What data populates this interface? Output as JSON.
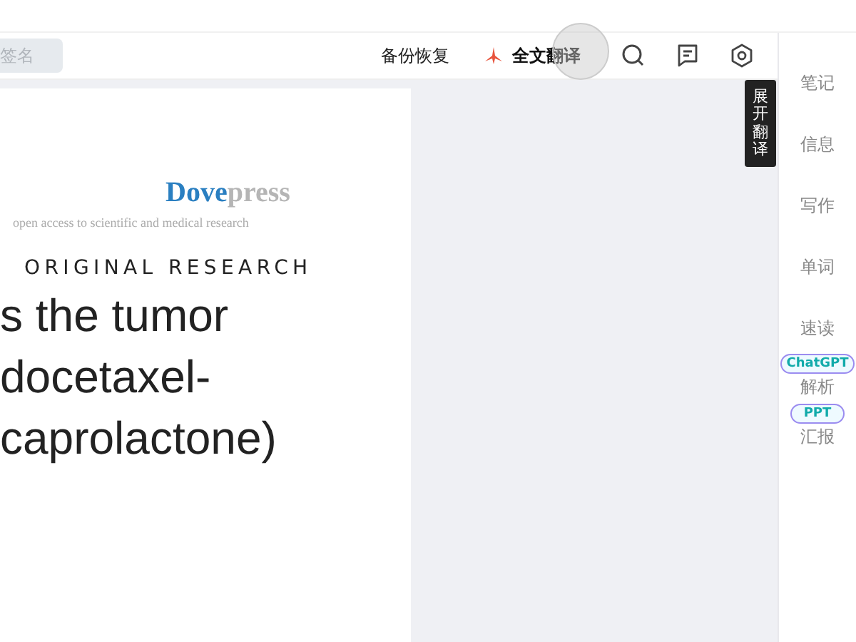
{
  "toolbar": {
    "search": {
      "placeholder": "签名"
    },
    "backup_label": "备份恢复",
    "translate_label": "全文翻译"
  },
  "tooltip": "展开翻译",
  "document": {
    "logo": [
      "Dove",
      "press"
    ],
    "tagline": "open access to scientific and medical research",
    "section": "ORIGINAL RESEARCH",
    "title_lines": [
      "s the tumor",
      "docetaxel-",
      "caprolactone)"
    ]
  },
  "sidebar": {
    "items": [
      {
        "label": "笔记"
      },
      {
        "label": "信息"
      },
      {
        "label": "写作"
      },
      {
        "label": "单词"
      },
      {
        "label": "速读"
      },
      {
        "label": "解析",
        "badge": "ChatGPT"
      },
      {
        "label": "汇报",
        "badge": "PPT"
      }
    ]
  }
}
